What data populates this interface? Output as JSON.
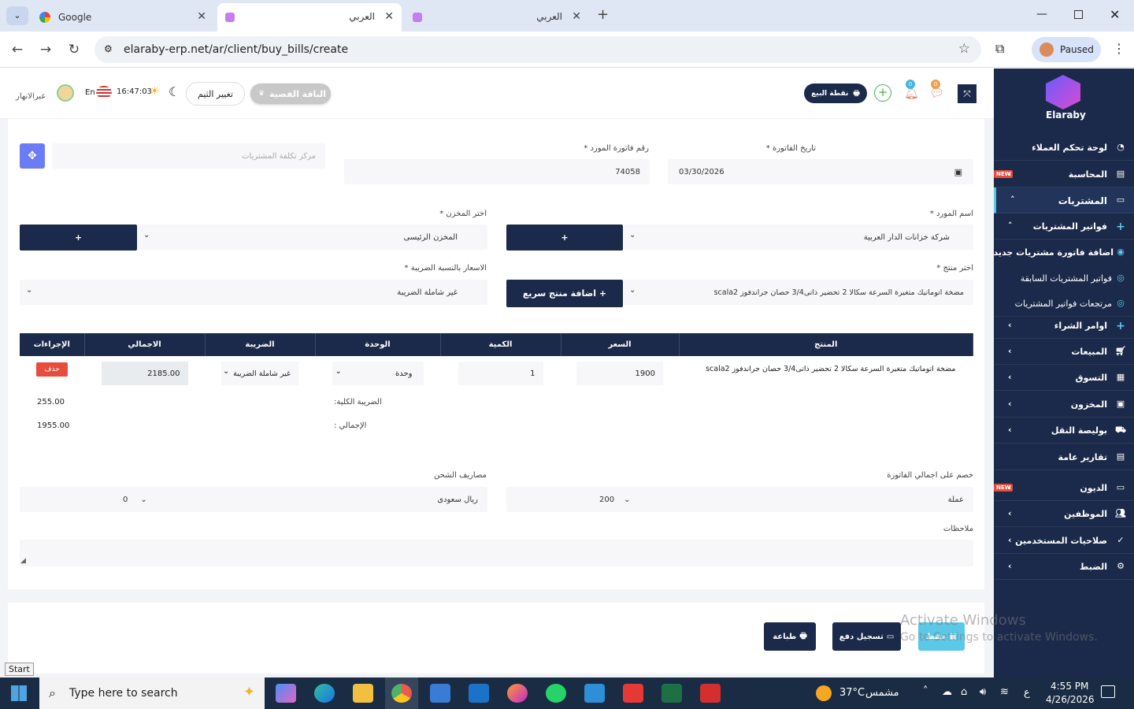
{
  "browser": {
    "tabs": [
      {
        "title": "Google"
      },
      {
        "title": "العربي"
      },
      {
        "title": "العربي"
      }
    ],
    "new_tab": "+",
    "url": "elaraby-erp.net/ar/client/buy_bills/create",
    "profile_status": "Paused"
  },
  "header": {
    "user_name": "عبرالانهار",
    "lang": "En",
    "time": "16:47:03",
    "theme_button": "تغيير الثيم",
    "package_button": "الباقة الفضية",
    "pos_button": "نقطة البيع",
    "notif_count_1": "0",
    "notif_count_2": "0"
  },
  "sidebar": {
    "brand": "Elaraby",
    "items": [
      {
        "label": "لوحة تحكم العملاء"
      },
      {
        "label": "المحاسبة",
        "badge": "NEW"
      },
      {
        "label": "المشتريات"
      },
      {
        "label": "فواتير المشتريات"
      },
      {
        "label": "اضافة فاتورة مشتريات جديدة"
      },
      {
        "label": "فواتير المشتريات السابقة"
      },
      {
        "label": "مرتجعات فواتير المشتريات"
      },
      {
        "label": "اوامر الشراء"
      },
      {
        "label": "المبيعات"
      },
      {
        "label": "التسوق"
      },
      {
        "label": "المخزون"
      },
      {
        "label": "بوليصة النقل"
      },
      {
        "label": "تقارير عامة"
      },
      {
        "label": "الديون",
        "badge": "NEW"
      },
      {
        "label": "الموظفين"
      },
      {
        "label": "صلاحيات المستخدمين"
      },
      {
        "label": "الضبط"
      }
    ]
  },
  "form": {
    "invoice_date_label": "تاريخ الفاتورة *",
    "invoice_date": "03/30/2026",
    "supplier_invoice_label": "رقم فاتورة المورد *",
    "supplier_invoice": "74058",
    "cost_center_placeholder": "مركز تكلفة المشتريات",
    "supplier_label": "اسم المورد *",
    "supplier": "شركة خزانات الدار العربية",
    "warehouse_label": "اختر المخزن *",
    "warehouse": "المخزن الرئيسى",
    "product_label": "اختر منتج *",
    "product": "مضخة اتوماتيك متغيرة السرعة سكالا 2 تحضير ذاتى3/4 حصان جراندفوز scala2",
    "quick_add": "اضافة منتج سريع +",
    "tax_prices_label": "الاسعار بالنسبة الضريبة *",
    "tax_prices": "غير شاملة الضريبة",
    "plus": "+"
  },
  "table": {
    "headers": [
      "المنتج",
      "السعر",
      "الكمية",
      "الوحدة",
      "الضريبة",
      "الاجمالي",
      "الإجراءات"
    ],
    "row": {
      "product": "مضخة اتوماتيك متغيرة السرعة سكالا 2 تحضير ذاتى3/4 حصان جراندفوز scala2",
      "price": "1900",
      "qty": "1",
      "unit": "وحدة",
      "tax": "غير شاملة الضريبة",
      "total": "2185.00",
      "delete": "حذف"
    },
    "total_tax_label": "الضريبة الكلية:",
    "total_tax": "255.00",
    "grand_total_label": "الإجمالي :",
    "grand_total": "1955.00"
  },
  "discount": {
    "label": "خصم على اجمالي الفاتورة",
    "type": "عملة",
    "value": "200"
  },
  "shipping": {
    "label": "مصاريف الشحن",
    "currency": "ريال سعودى",
    "value": "0"
  },
  "notes_label": "ملاحظات",
  "footer": {
    "print": "طباعة",
    "payment": "تسجيل دفع",
    "save": "حفظ"
  },
  "watermark": {
    "line1": "Activate Windows",
    "line2": "Go to Settings to activate Windows."
  },
  "taskbar": {
    "start_tooltip": "Start",
    "search_placeholder": "Type here to search",
    "weather": "37°C",
    "weather_desc": "مشمس",
    "lang": "ع",
    "clock_time": "4:55 PM",
    "clock_date": "4/26/2026"
  },
  "colors": {
    "navy": "#1b2a4a",
    "accent": "#6c7cf5",
    "danger": "#e74c3c",
    "save": "#5bc8e8"
  }
}
